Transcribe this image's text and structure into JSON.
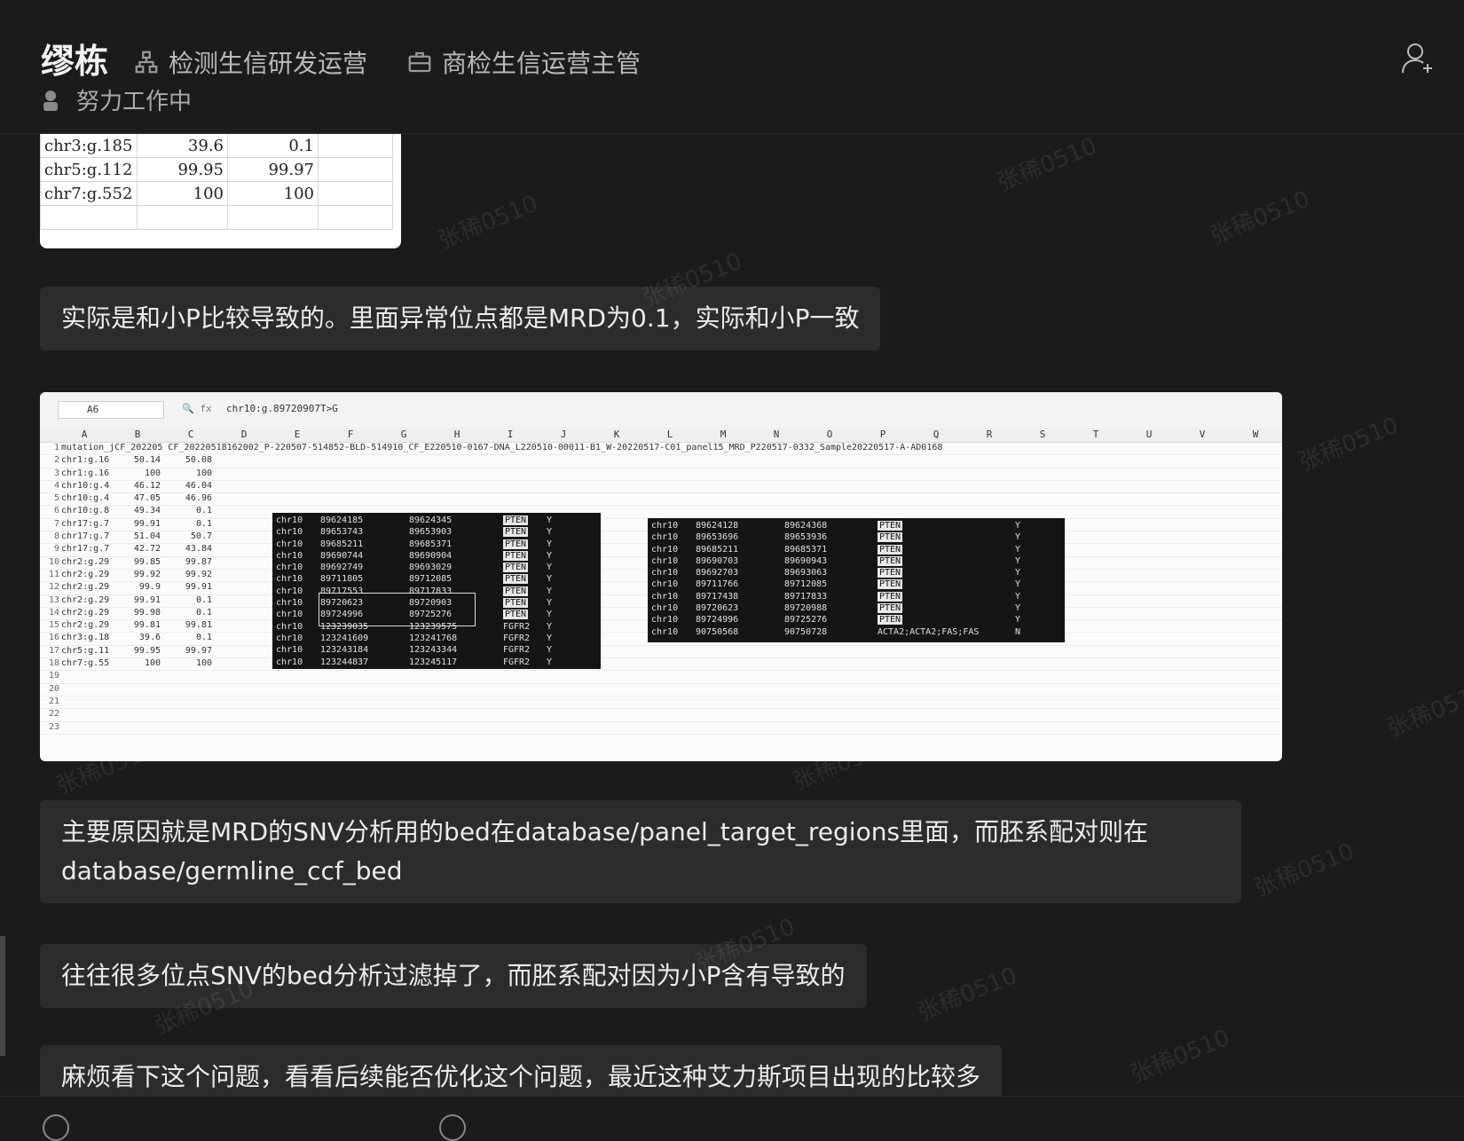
{
  "header": {
    "name": "缪栋",
    "dept1": "检测生信研发运营",
    "dept2": "商检生信运营主管",
    "status": "努力工作中"
  },
  "icons": [
    "org-chart-icon",
    "briefcase-icon",
    "status-avatar-icon",
    "add-user-icon"
  ],
  "sheet_crop": {
    "rows": [
      [
        "chr3:g.185",
        "39.6",
        "0.1"
      ],
      [
        "chr5:g.112",
        "99.95",
        "99.97"
      ],
      [
        "chr7:g.552",
        "100",
        "100"
      ]
    ]
  },
  "messages": [
    "实际是和小P比较导致的。里面异常位点都是MRD为0.1，实际和小P一致",
    "主要原因就是MRD的SNV分析用的bed在database/panel_target_regions里面，而胚系配对则在database/germline_ccf_bed",
    "往往很多位点SNV的bed分析过滤掉了，而胚系配对因为小P含有导致的",
    "麻烦看下这个问题，看看后续能否优化这个问题，最近这种艾力斯项目出现的比较多"
  ],
  "screenshot": {
    "cell_ref": "A6",
    "formula": "chr10:g.89720907T>G",
    "columns": [
      "A",
      "B",
      "C",
      "D",
      "E",
      "F",
      "G",
      "H",
      "I",
      "J",
      "K",
      "L",
      "M",
      "N",
      "O",
      "P",
      "Q",
      "R",
      "S",
      "T",
      "U",
      "V",
      "W"
    ],
    "row1_text": "mutation_jCF_202205 CF_20220518162002_P-220507-514852-BLD-514910_CF_E220510-0167-DNA_L220510-00011-B1_W-20220517-C01_panel15_MRD_P220517-0332_Sample20220517-A-AD0168",
    "rows": [
      [
        "chr1:g.16",
        "50.14",
        "50.08"
      ],
      [
        "chr1:g.16",
        "100",
        "100"
      ],
      [
        "chr10:g.4",
        "46.12",
        "46.04"
      ],
      [
        "chr10:g.4",
        "47.05",
        "46.96"
      ],
      [
        "chr10:g.8",
        "49.34",
        "0.1"
      ],
      [
        "chr17:g.7",
        "99.91",
        "0.1"
      ],
      [
        "chr17:g.7",
        "51.04",
        "50.7"
      ],
      [
        "chr17:g.7",
        "42.72",
        "43.84"
      ],
      [
        "chr2:g.29",
        "99.85",
        "99.87"
      ],
      [
        "chr2:g.29",
        "99.92",
        "99.92"
      ],
      [
        "chr2:g.29",
        "99.9",
        "99.91"
      ],
      [
        "chr2:g.29",
        "99.91",
        "0.1"
      ],
      [
        "chr2:g.29",
        "99.98",
        "0.1"
      ],
      [
        "chr2:g.29",
        "99.81",
        "99.81"
      ],
      [
        "chr3:g.18",
        "39.6",
        "0.1"
      ],
      [
        "chr5:g.11",
        "99.95",
        "99.97"
      ],
      [
        "chr7:g.55",
        "100",
        "100"
      ]
    ],
    "empty_rows": [
      "19",
      "20",
      "21",
      "22",
      "23"
    ],
    "terminal1": [
      [
        "chr10",
        "89624185",
        "89624345",
        "PTEN",
        "Y"
      ],
      [
        "chr10",
        "89653743",
        "89653903",
        "PTEN",
        "Y"
      ],
      [
        "chr10",
        "89685211",
        "89685371",
        "PTEN",
        "Y"
      ],
      [
        "chr10",
        "89690744",
        "89690904",
        "PTEN",
        "Y"
      ],
      [
        "chr10",
        "89692749",
        "89693029",
        "PTEN",
        "Y"
      ],
      [
        "chr10",
        "89711805",
        "89712085",
        "PTEN",
        "Y"
      ],
      [
        "chr10",
        "89717553",
        "89717833",
        "PTEN",
        "Y"
      ],
      [
        "chr10",
        "89720623",
        "89720903",
        "PTEN",
        "Y"
      ],
      [
        "chr10",
        "89724996",
        "89725276",
        "PTEN",
        "Y"
      ],
      [
        "chr10",
        "123239035",
        "123239575",
        "FGFR2",
        "Y"
      ],
      [
        "chr10",
        "123241609",
        "123241768",
        "FGFR2",
        "Y"
      ],
      [
        "chr10",
        "123243184",
        "123243344",
        "FGFR2",
        "Y"
      ],
      [
        "chr10",
        "123244837",
        "123245117",
        "FGFR2",
        "Y"
      ]
    ],
    "terminal2": [
      [
        "chr10",
        "89624128",
        "89624368",
        "PTEN",
        "Y"
      ],
      [
        "chr10",
        "89653696",
        "89653936",
        "PTEN",
        "Y"
      ],
      [
        "chr10",
        "89685211",
        "89685371",
        "PTEN",
        "Y"
      ],
      [
        "chr10",
        "89690703",
        "89690943",
        "PTEN",
        "Y"
      ],
      [
        "chr10",
        "89692703",
        "89693063",
        "PTEN",
        "Y"
      ],
      [
        "chr10",
        "89711766",
        "89712085",
        "PTEN",
        "Y"
      ],
      [
        "chr10",
        "89717438",
        "89717833",
        "PTEN",
        "Y"
      ],
      [
        "chr10",
        "89720623",
        "89720988",
        "PTEN",
        "Y"
      ],
      [
        "chr10",
        "89724996",
        "89725276",
        "PTEN",
        "Y"
      ],
      [
        "chr10",
        "90750568",
        "90750728",
        "ACTA2;ACTA2;FAS;FAS",
        "N"
      ]
    ]
  },
  "watermark": "张稀0510"
}
